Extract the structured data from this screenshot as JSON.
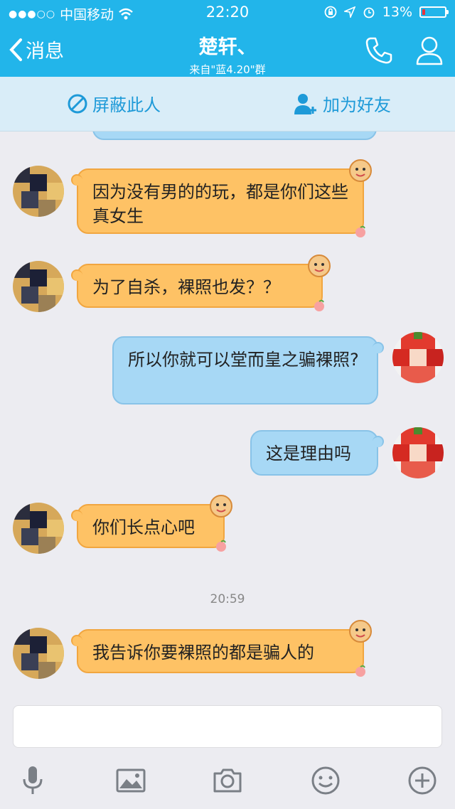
{
  "status_bar": {
    "carrier": "中国移动",
    "time": "22:20",
    "battery": "13%",
    "battery_level": 0.13,
    "battery_color": "#e8333a"
  },
  "nav": {
    "back_label": "消息",
    "title": "楚轩、",
    "subtitle": "来自\"蓝4.20\"群",
    "icons": [
      "phone-icon",
      "profile-icon"
    ],
    "bar_color": "#22b5ea"
  },
  "actions": {
    "block_label": "屏蔽此人",
    "add_friend_label": "加为好友"
  },
  "messages": [
    {
      "side": "in",
      "text": "因为没有男的的玩，都是你们这些真女生"
    },
    {
      "side": "in",
      "text": "为了自杀，裸照也发？？"
    },
    {
      "side": "out",
      "text": "所以你就可以堂而皇之骗裸照?"
    },
    {
      "side": "out",
      "text": "这是理由吗"
    },
    {
      "side": "in",
      "text": "你们长点心吧"
    },
    {
      "side": "in",
      "text": "我告诉你要裸照的都是骗人的"
    }
  ],
  "timestamp": "20:59",
  "toolbar": {
    "icons": [
      "microphone-icon",
      "image-icon",
      "camera-icon",
      "emoji-icon",
      "plus-icon"
    ]
  },
  "colors": {
    "incoming_bubble": "#fec265",
    "outgoing_bubble": "#a7d8f5",
    "accent": "#1e9ad8"
  }
}
